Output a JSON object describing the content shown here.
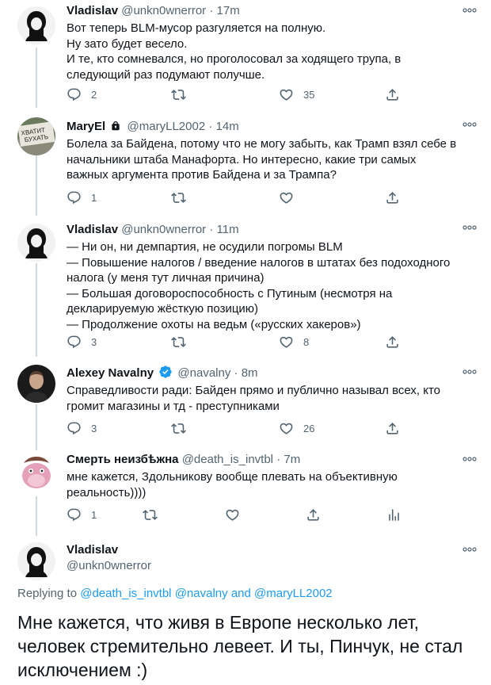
{
  "tweets": [
    {
      "name": "Vladislav",
      "handle": "@unkn0wnerror",
      "time": "17m",
      "lines": [
        "Вот теперь BLM-мусор разгуляется на полную.",
        "Ну зато будет весело.",
        "И те, кто сомневался, но проголосовал за ходящего трупа, в",
        "следующий раз подумают получше."
      ],
      "reply_count": "2",
      "retweet_count": "",
      "like_count": "35"
    },
    {
      "name": "MaryEl",
      "handle": "@maryLL2002",
      "time": "14m",
      "avatar_text_1": "ХВАТИТ",
      "avatar_text_2": "БУХАТЬ",
      "lines": [
        "Болела за Байдена, потому что не могу забыть, как Трамп взял себе в",
        "начальники штаба Манафорта. Но интересно, какие три самых",
        "важных аргумента против Байдена и за Трампа?"
      ],
      "reply_count": "1",
      "retweet_count": "",
      "like_count": ""
    },
    {
      "name": "Vladislav",
      "handle": "@unkn0wnerror",
      "time": "11m",
      "lines": [
        "— Ни он, ни демпартия, не осудили погромы BLM",
        "— Повышение налогов / введение налогов в штатах без подоходного",
        "налога (у меня тут личная причина)",
        "— Большая договороспособность с Путиным (несмотря на",
        "декларируемую жёсткую позицию)",
        "— Продолжение охоты на ведьм («русских хакеров»)"
      ],
      "reply_count": "3",
      "retweet_count": "",
      "like_count": "8"
    },
    {
      "name": "Alexey Navalny",
      "handle": "@navalny",
      "time": "8m",
      "lines": [
        "Справедливости ради: Байден прямо и публично называл всех, кто",
        "громит магазины и тд - преступниками"
      ],
      "reply_count": "3",
      "retweet_count": "",
      "like_count": "26"
    },
    {
      "name": "Смерть неизбѣжна",
      "handle": "@death_is_invtbl",
      "time": "7m",
      "lines": [
        "мне кажется, Здольникову вообще плевать на объективную",
        "реальность))))"
      ],
      "reply_count": "1",
      "retweet_count": "",
      "like_count": ""
    }
  ],
  "main_tweet": {
    "name": "Vladislav",
    "handle": "@unkn0wnerror",
    "replying_prefix": "Replying to",
    "replying_user_1": "@death_is_invtbl",
    "replying_user_2": "@navalny",
    "replying_and": "and",
    "replying_user_3": "@maryLL2002",
    "lines": [
      "Мне кажется, что живя в Европе несколько лет,",
      "человек стремительно левеет. И ты, Пинчук, не стал",
      "исключением :)"
    ]
  },
  "time_separator": "·",
  "icons": {
    "reply": "reply-icon",
    "retweet": "retweet-icon",
    "like": "heart-icon",
    "share": "share-icon",
    "analytics": "analytics-icon",
    "more": "more-icon",
    "verified": "verified-badge-icon",
    "protected": "lock-icon"
  },
  "colors": {
    "text": "#0f1419",
    "secondary": "#536471",
    "link": "#1d9bf0",
    "verified": "#1d9bf0",
    "thread_line": "#cfd9de"
  }
}
